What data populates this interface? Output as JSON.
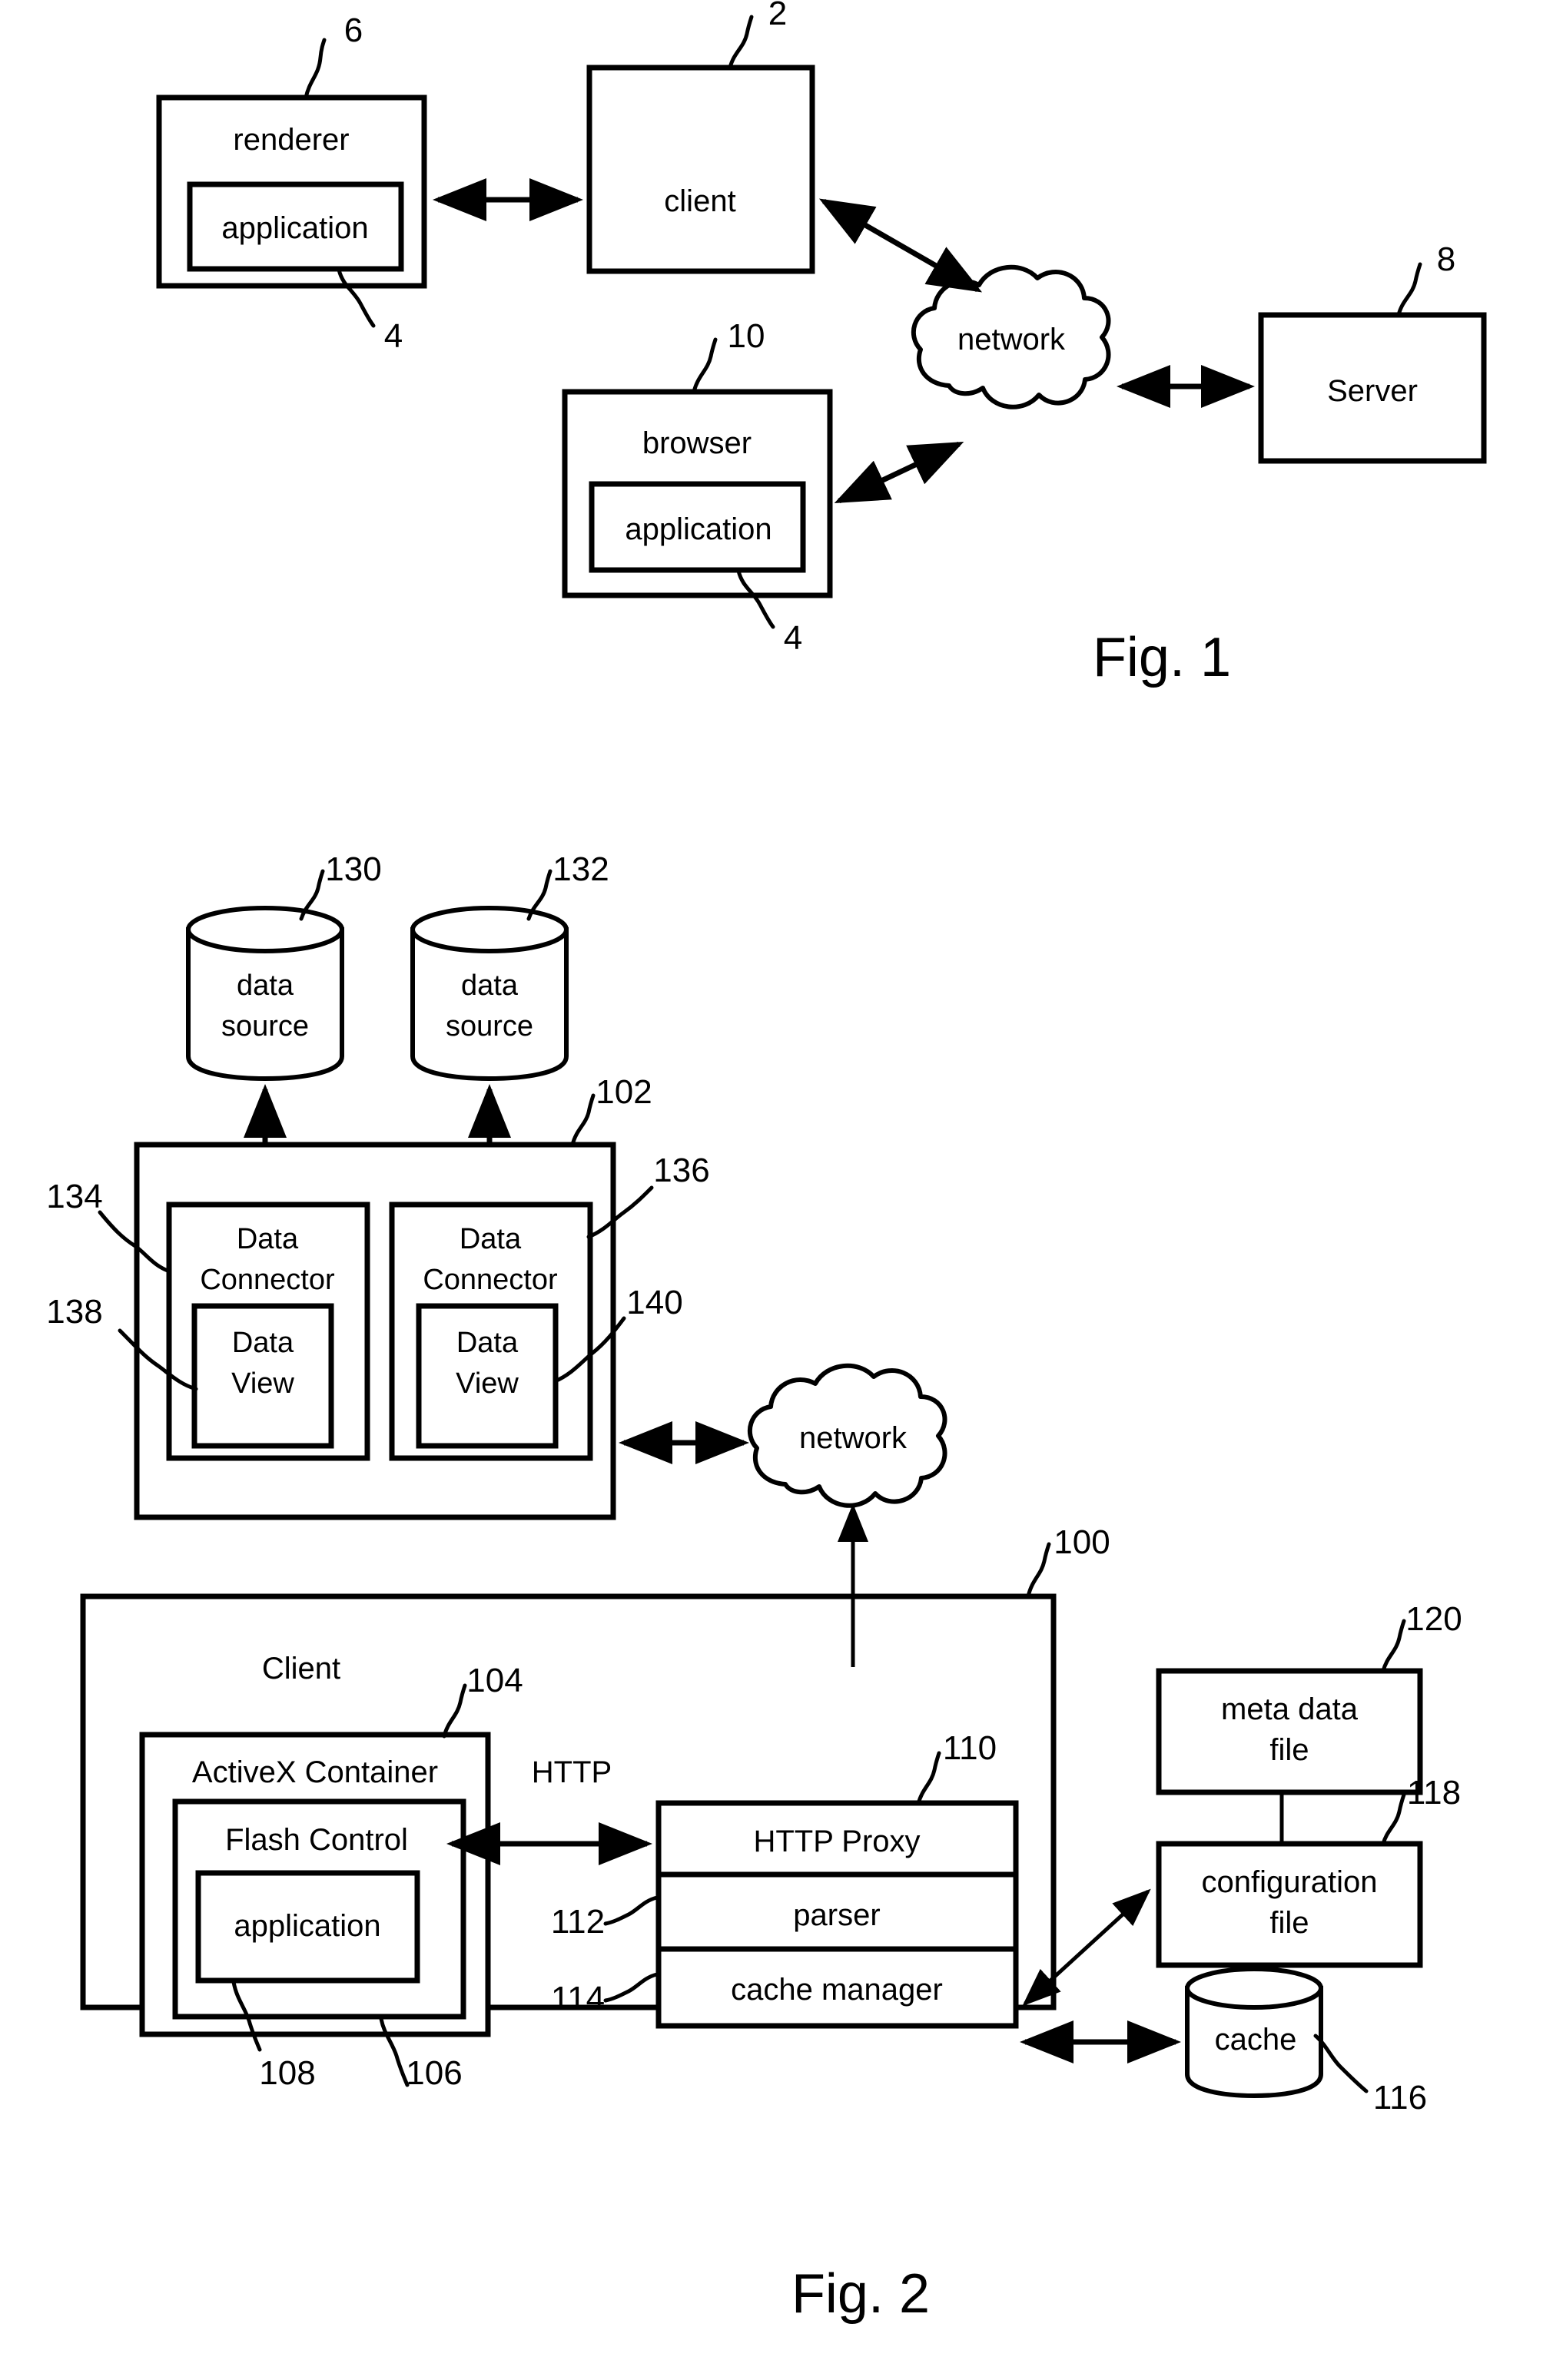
{
  "document": {
    "type": "patent-drawing-sheet",
    "figures": [
      "Fig. 1",
      "Fig. 2"
    ]
  },
  "fig1": {
    "caption": "Fig. 1",
    "nodes": {
      "renderer": {
        "label": "renderer",
        "ref": "6"
      },
      "renderer_application": {
        "label": "application",
        "ref": "4"
      },
      "client": {
        "label": "client",
        "ref": "2"
      },
      "browser": {
        "label": "browser",
        "ref": "10"
      },
      "browser_application": {
        "label": "application",
        "ref": "4"
      },
      "network": {
        "label": "network"
      },
      "server": {
        "label": "Server",
        "ref": "8"
      }
    },
    "connections": [
      {
        "from": "renderer",
        "to": "client",
        "style": "double-arrow"
      },
      {
        "from": "client",
        "to": "network",
        "style": "double-arrow-diagonal"
      },
      {
        "from": "browser",
        "to": "network",
        "style": "double-arrow-diagonal"
      },
      {
        "from": "network",
        "to": "server",
        "style": "double-arrow"
      }
    ]
  },
  "fig2": {
    "caption": "Fig. 2",
    "nodes": {
      "data_source_1": {
        "label_line1": "data",
        "label_line2": "source",
        "ref": "130"
      },
      "data_source_2": {
        "label_line1": "data",
        "label_line2": "source",
        "ref": "132"
      },
      "outer_connector_box": {
        "ref": "102"
      },
      "data_connector_1": {
        "label_line1": "Data",
        "label_line2": "Connector",
        "ref": "134"
      },
      "data_connector_2": {
        "label_line1": "Data",
        "label_line2": "Connector",
        "ref": "136"
      },
      "data_view_1": {
        "label_line1": "Data",
        "label_line2": "View",
        "ref": "138"
      },
      "data_view_2": {
        "label_line1": "Data",
        "label_line2": "View",
        "ref": "140"
      },
      "network": {
        "label": "network"
      },
      "client_box": {
        "label": "Client",
        "ref": "100"
      },
      "activex_container": {
        "label": "ActiveX Container",
        "ref": "104"
      },
      "flash_control": {
        "label": "Flash Control",
        "ref": "106"
      },
      "flash_application": {
        "label": "application",
        "ref": "108"
      },
      "http_proxy": {
        "label": "HTTP Proxy",
        "ref": "110"
      },
      "parser": {
        "label": "parser",
        "ref": "112"
      },
      "cache_manager": {
        "label": "cache manager",
        "ref": "114"
      },
      "meta_data_file": {
        "label_line1": "meta data",
        "label_line2": "file",
        "ref": "120"
      },
      "configuration_file": {
        "label_line1": "configuration",
        "label_line2": "file",
        "ref": "118"
      },
      "cache": {
        "label": "cache",
        "ref": "116"
      }
    },
    "edge_labels": {
      "http": "HTTP"
    },
    "connections": [
      {
        "from": "data_source_1",
        "to": "data_connector_1",
        "style": "double-arrow-vertical"
      },
      {
        "from": "data_source_2",
        "to": "data_connector_2",
        "style": "double-arrow-vertical"
      },
      {
        "from": "outer_connector_box",
        "to": "network",
        "style": "double-arrow"
      },
      {
        "from": "client_box",
        "to": "network",
        "style": "arrow-up"
      },
      {
        "from": "flash_control",
        "to": "http_proxy",
        "style": "double-arrow",
        "label": "HTTP"
      },
      {
        "from": "cache_manager",
        "to": "configuration_file",
        "style": "double-arrow-diagonal"
      },
      {
        "from": "cache_manager",
        "to": "cache",
        "style": "double-arrow"
      },
      {
        "from": "meta_data_file",
        "to": "configuration_file",
        "style": "line"
      }
    ]
  }
}
